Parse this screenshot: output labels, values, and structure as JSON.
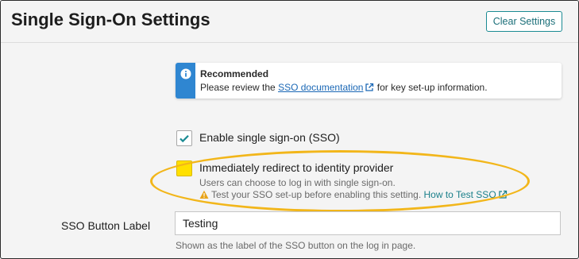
{
  "header": {
    "title": "Single Sign-On Settings",
    "clear_button_label": "Clear Settings"
  },
  "notice": {
    "icon": "info-icon",
    "title": "Recommended",
    "text_before": "Please review the ",
    "link_text": "SSO documentation",
    "text_after": " for key set-up information."
  },
  "options": {
    "enable_sso": {
      "label": "Enable single sign-on (SSO)",
      "checked": true
    },
    "redirect": {
      "label": "Immediately redirect to identity provider",
      "checked": false,
      "help_line1": "Users can choose to log in with single sign-on.",
      "warning_text": "Test your SSO set-up before enabling this setting.",
      "howto_link": "How to Test SSO"
    }
  },
  "sso_button_label": {
    "label": "SSO Button Label",
    "value": "Testing",
    "help": "Shown as the label of the SSO button on the log in page."
  },
  "colors": {
    "accent": "#1b8b93",
    "info": "#2f86d1",
    "highlight": "#f2b61a",
    "checkbox_highlight": "#ffe000"
  }
}
